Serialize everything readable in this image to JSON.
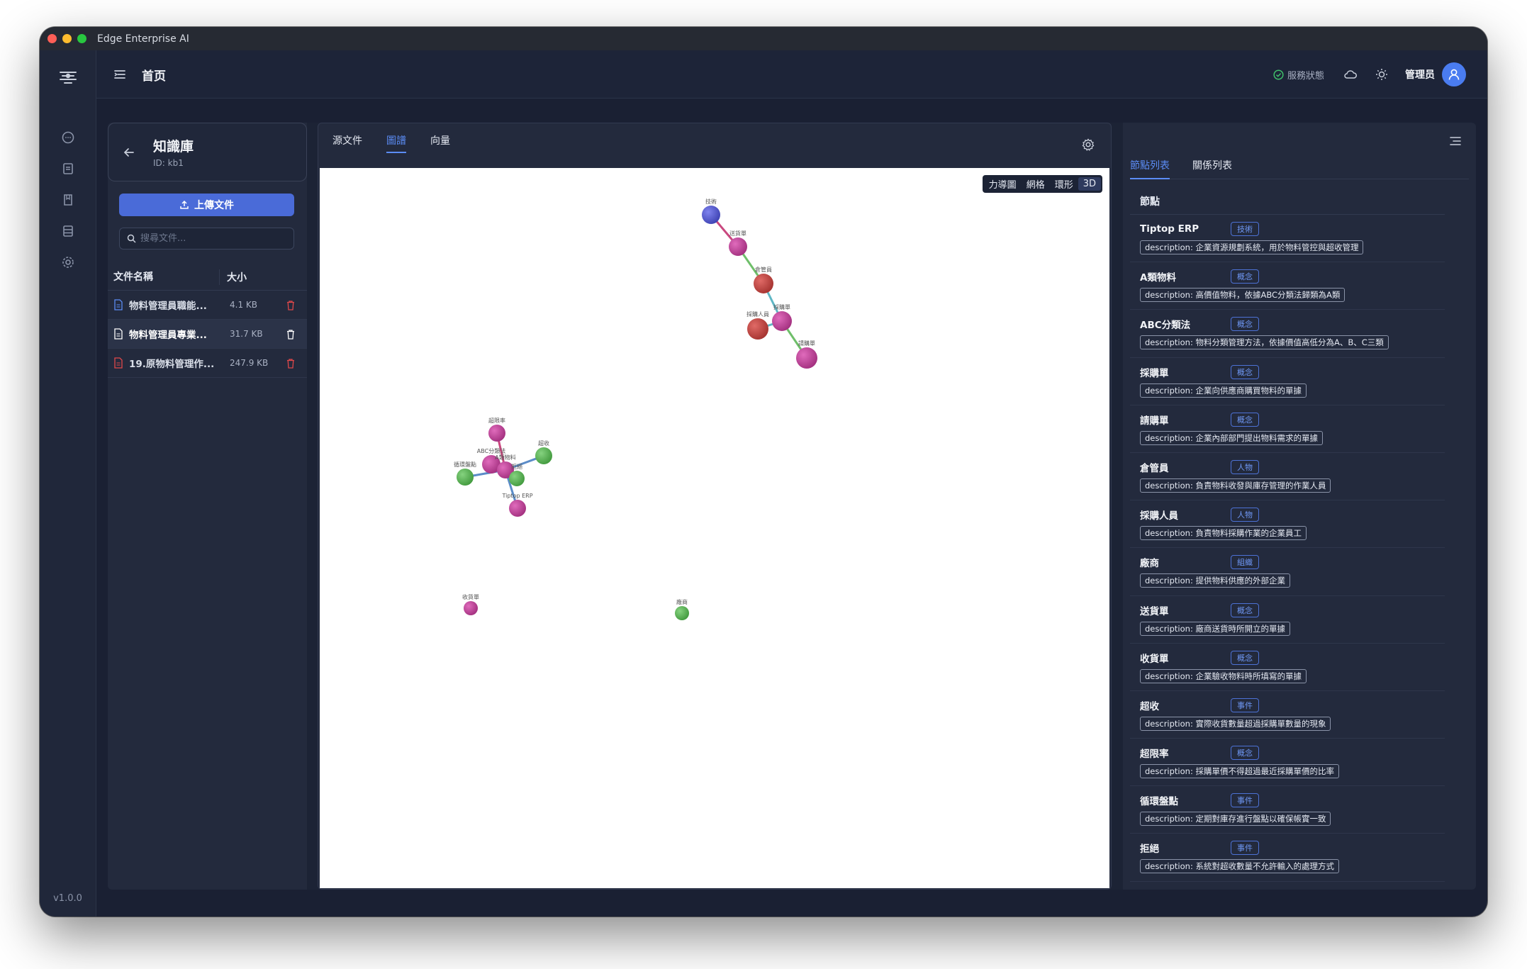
{
  "window": {
    "title": "Edge Enterprise AI"
  },
  "rail": {
    "version": "v1.0.0"
  },
  "header": {
    "breadcrumb": "首页",
    "status_label": "服務狀態",
    "user_name": "管理员"
  },
  "kb": {
    "title": "知識庫",
    "id_label": "ID: kb1",
    "upload_label": "上傳文件",
    "search_placeholder": "搜尋文件...",
    "col_name": "文件名稱",
    "col_size": "大小",
    "files": [
      {
        "name": "物料管理員職能...",
        "size": "4.1 KB",
        "type": "doc"
      },
      {
        "name": "物料管理員專業...",
        "size": "31.7 KB",
        "type": "doc"
      },
      {
        "name": "19.原物料管理作...",
        "size": "247.9 KB",
        "type": "pdf"
      }
    ]
  },
  "center": {
    "tabs": [
      "源文件",
      "圖譜",
      "向量"
    ],
    "active_tab": "圖譜",
    "layouts": [
      "力導圖",
      "網格",
      "環形",
      "3D"
    ],
    "active_layout": "3D",
    "graph": {
      "nodes": [
        {
          "label": "技術",
          "color": "#5a5fcf"
        },
        {
          "label": "送貨單",
          "color": "#c2429a"
        },
        {
          "label": "倉管員",
          "color": "#c7433f"
        },
        {
          "label": "採購單",
          "color": "#c2429a"
        },
        {
          "label": "採購人員",
          "color": "#c7433f"
        },
        {
          "label": "請購單",
          "color": "#c2429a"
        },
        {
          "label": "超限率",
          "color": "#c2429a"
        },
        {
          "label": "ABC分類法",
          "color": "#c2429a"
        },
        {
          "label": "A類物料",
          "color": "#c2429a"
        },
        {
          "label": "拒絕",
          "color": "#5fb85a"
        },
        {
          "label": "超收",
          "color": "#5fb85a"
        },
        {
          "label": "循環盤點",
          "color": "#5fb85a"
        },
        {
          "label": "Tiptop ERP",
          "color": "#c2429a"
        },
        {
          "label": "收貨單",
          "color": "#c2429a"
        },
        {
          "label": "廠商",
          "color": "#5fb85a"
        }
      ]
    }
  },
  "right": {
    "tabs": [
      "節點列表",
      "關係列表"
    ],
    "active_tab": "節點列表",
    "section_title": "節點",
    "nodes": [
      {
        "name": "Tiptop ERP",
        "tag": "技術",
        "desc": "description: 企業資源規劃系統，用於物料管控與超收管理"
      },
      {
        "name": "A類物料",
        "tag": "概念",
        "desc": "description: 高價值物料，依據ABC分類法歸類為A類"
      },
      {
        "name": "ABC分類法",
        "tag": "概念",
        "desc": "description: 物料分類管理方法，依據價值高低分為A、B、C三類"
      },
      {
        "name": "採購單",
        "tag": "概念",
        "desc": "description: 企業向供應商購買物料的單據"
      },
      {
        "name": "請購單",
        "tag": "概念",
        "desc": "description: 企業內部部門提出物料需求的單據"
      },
      {
        "name": "倉管員",
        "tag": "人物",
        "desc": "description: 負責物料收發與庫存管理的作業人員"
      },
      {
        "name": "採購人員",
        "tag": "人物",
        "desc": "description: 負責物料採購作業的企業員工"
      },
      {
        "name": "廠商",
        "tag": "組織",
        "desc": "description: 提供物料供應的外部企業"
      },
      {
        "name": "送貨單",
        "tag": "概念",
        "desc": "description: 廠商送貨時所開立的單據"
      },
      {
        "name": "收貨單",
        "tag": "概念",
        "desc": "description: 企業驗收物料時所填寫的單據"
      },
      {
        "name": "超收",
        "tag": "事件",
        "desc": "description: 實際收貨數量超過採購單數量的現象"
      },
      {
        "name": "超限率",
        "tag": "概念",
        "desc": "description: 採購單價不得超過最近採購單價的比率"
      },
      {
        "name": "循環盤點",
        "tag": "事件",
        "desc": "description: 定期對庫存進行盤點以確保帳實一致"
      },
      {
        "name": "拒絕",
        "tag": "事件",
        "desc": "description: 系統對超收數量不允許輸入的處理方式"
      }
    ]
  }
}
